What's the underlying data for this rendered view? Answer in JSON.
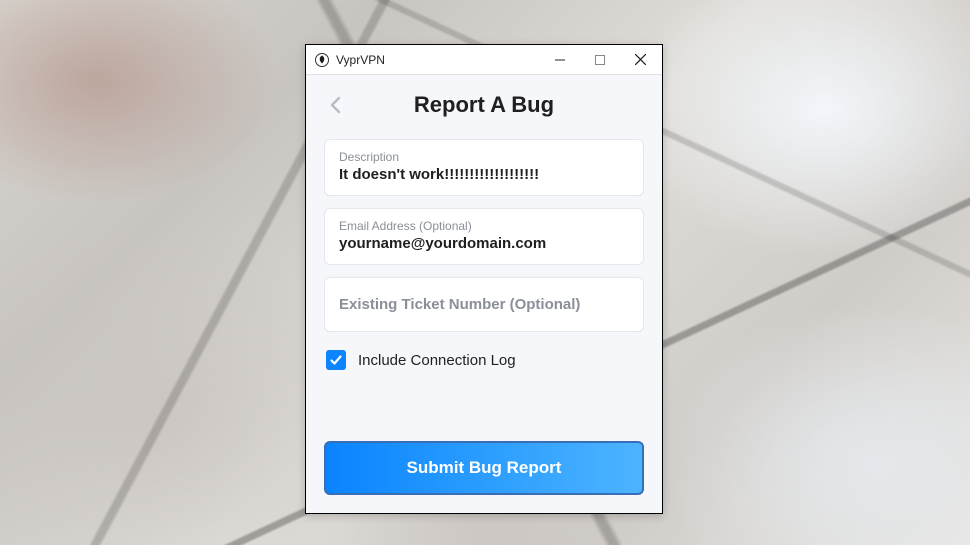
{
  "titlebar": {
    "app_name": "VyprVPN"
  },
  "header": {
    "title": "Report A Bug"
  },
  "form": {
    "description": {
      "label": "Description",
      "value": "It doesn't work!!!!!!!!!!!!!!!!!!!"
    },
    "email": {
      "label": "Email Address (Optional)",
      "value": "yourname@yourdomain.com"
    },
    "ticket": {
      "placeholder": "Existing Ticket Number (Optional)",
      "value": ""
    },
    "include_log": {
      "label": "Include Connection Log",
      "checked": true
    }
  },
  "actions": {
    "submit_label": "Submit Bug Report"
  }
}
